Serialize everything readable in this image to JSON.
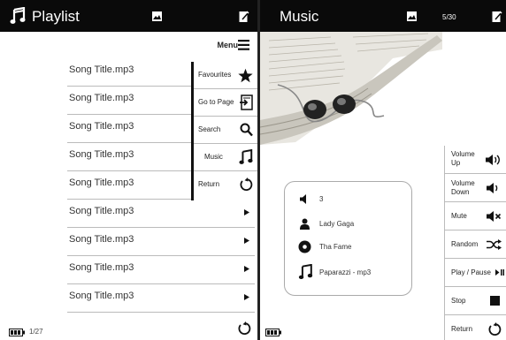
{
  "colors": {
    "topbar": "#0a0a0a",
    "accent": "#111111",
    "divider": "#bbbbbb"
  },
  "playlist": {
    "title": "Playlist",
    "title_icon": "music-note-icon",
    "menu_label": "Menu",
    "songs": [
      "Song Title.mp3",
      "Song Title.mp3",
      "Song Title.mp3",
      "Song Title.mp3",
      "Song Title.mp3",
      "Song Title.mp3",
      "Song Title.mp3",
      "Song Title.mp3",
      "Song Title.mp3"
    ],
    "context_menu": [
      {
        "label": "Favourites",
        "icon": "star-icon"
      },
      {
        "label": "Go to Page",
        "icon": "page-arrow-icon"
      },
      {
        "label": "Search",
        "icon": "search-icon"
      },
      {
        "label": "Music",
        "icon": "music-note-icon"
      },
      {
        "label": "Return",
        "icon": "return-icon"
      }
    ],
    "page_indicator": "1/27"
  },
  "music": {
    "title": "Music",
    "track_count": "5/30",
    "now_playing": {
      "volume": "3",
      "artist": "Lady Gaga",
      "album": "Tha Fame",
      "track": "Paparazzi - mp3"
    },
    "controls": [
      {
        "label": "Volume\nUp",
        "icon": "volume-up-icon"
      },
      {
        "label": "Volume\nDown",
        "icon": "volume-down-icon"
      },
      {
        "label": "Mute",
        "icon": "mute-icon"
      },
      {
        "label": "Random",
        "icon": "shuffle-icon"
      },
      {
        "label": "Play / Pause",
        "icon": "play-pause-icon"
      },
      {
        "label": "Stop",
        "icon": "stop-icon"
      },
      {
        "label": "Return",
        "icon": "return-icon"
      }
    ]
  }
}
